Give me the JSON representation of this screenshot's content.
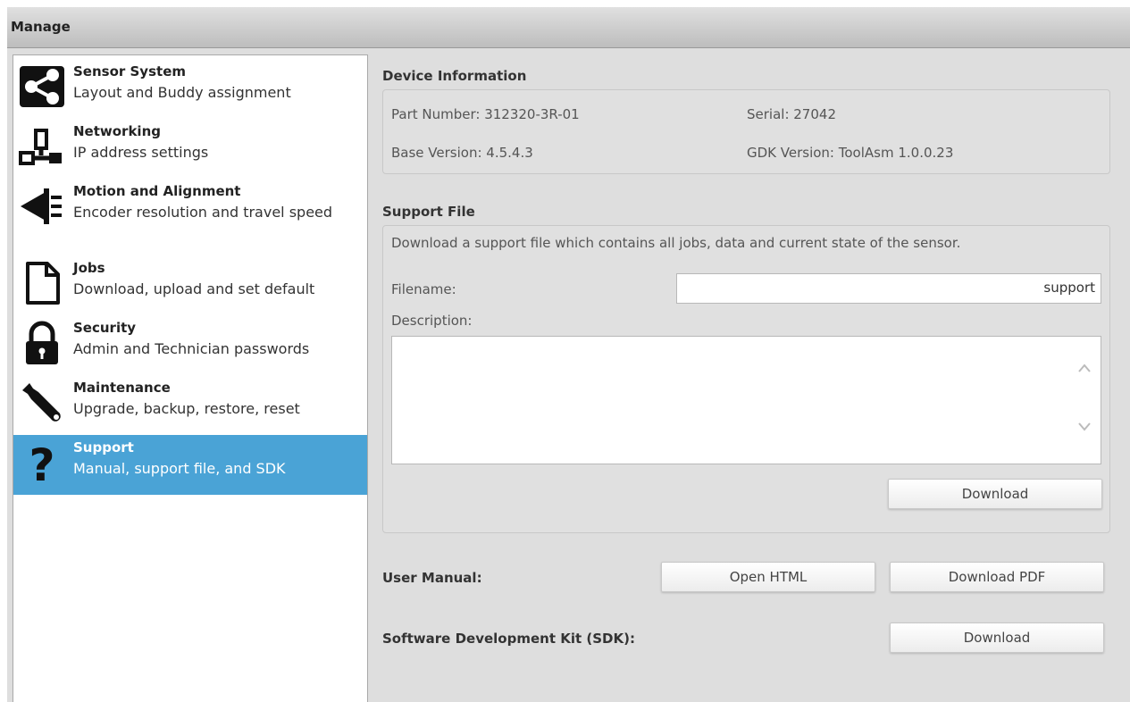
{
  "window": {
    "title": "Manage"
  },
  "sidebar": {
    "items": [
      {
        "title": "Sensor System",
        "subtitle": "Layout and Buddy assignment",
        "icon": "share-network-icon"
      },
      {
        "title": "Networking",
        "subtitle": "IP address settings",
        "icon": "network-plug-icon"
      },
      {
        "title": "Motion and Alignment",
        "subtitle": "Encoder resolution and travel speed",
        "icon": "arrow-left-bars-icon"
      },
      {
        "title": "Jobs",
        "subtitle": "Download, upload and set default",
        "icon": "document-icon"
      },
      {
        "title": "Security",
        "subtitle": "Admin and Technician passwords",
        "icon": "lock-icon"
      },
      {
        "title": "Maintenance",
        "subtitle": "Upgrade, backup, restore, reset",
        "icon": "wrench-icon"
      },
      {
        "title": "Support",
        "subtitle": "Manual, support file, and SDK",
        "icon": "question-icon",
        "selected": true
      }
    ],
    "selected_color": "#4aa3d6"
  },
  "device_info": {
    "title": "Device Information",
    "part_number": "Part Number:  312320-3R-01",
    "serial": "Serial:  27042",
    "base_version": "Base Version:  4.5.4.3",
    "gdk_version": "GDK Version:  ToolAsm 1.0.0.23"
  },
  "support_file": {
    "title": "Support File",
    "description_text": "Download a support file which contains all jobs, data and current state of the sensor.",
    "filename_label": "Filename:",
    "filename_value": "support",
    "description_label": "Description:",
    "download_label": "Download"
  },
  "user_manual": {
    "label": "User Manual:",
    "open_html": "Open HTML",
    "download_pdf": "Download PDF"
  },
  "sdk": {
    "label": "Software Development Kit (SDK):",
    "download_label": "Download"
  }
}
